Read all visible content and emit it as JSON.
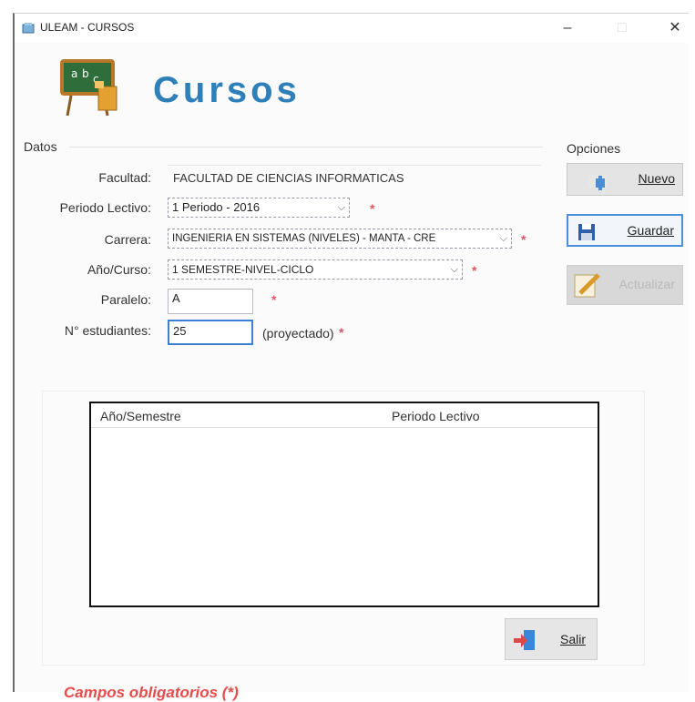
{
  "window": {
    "title": "ULEAM - CURSOS",
    "minimize": "–",
    "maximize": "□",
    "close": "✕"
  },
  "header": {
    "title": "Cursos",
    "logo_icon": "chalkboard-abc-icon"
  },
  "datos": {
    "group_label": "Datos",
    "facultad_label": "Facultad:",
    "facultad_value": "FACULTAD DE CIENCIAS INFORMATICAS",
    "periodo_label": "Periodo Lectivo:",
    "periodo_value": "1 Periodo - 2016",
    "carrera_label": "Carrera:",
    "carrera_value": "INGENIERIA EN SISTEMAS (NIVELES) - MANTA - CRE",
    "anio_label": "Año/Curso:",
    "anio_value": "1 SEMESTRE-NIVEL-CICLO",
    "paralelo_label": "Paralelo:",
    "paralelo_value": "A",
    "estudiantes_label": "N° estudiantes:",
    "estudiantes_value": "25",
    "proyectado_label": "(proyectado)",
    "required_mark": "*"
  },
  "opciones": {
    "group_label": "Opciones",
    "nuevo_label": "Nuevo",
    "guardar_label": "Guardar",
    "actualizar_label": "Actualizar"
  },
  "list": {
    "columns": [
      "Año/Semestre",
      "Periodo Lectivo"
    ]
  },
  "footer": {
    "salir_label": "Salir",
    "required_note": "Campos obligatorios (*)"
  },
  "colors": {
    "accent": "#2f7fb8",
    "required": "#e54b4b"
  }
}
